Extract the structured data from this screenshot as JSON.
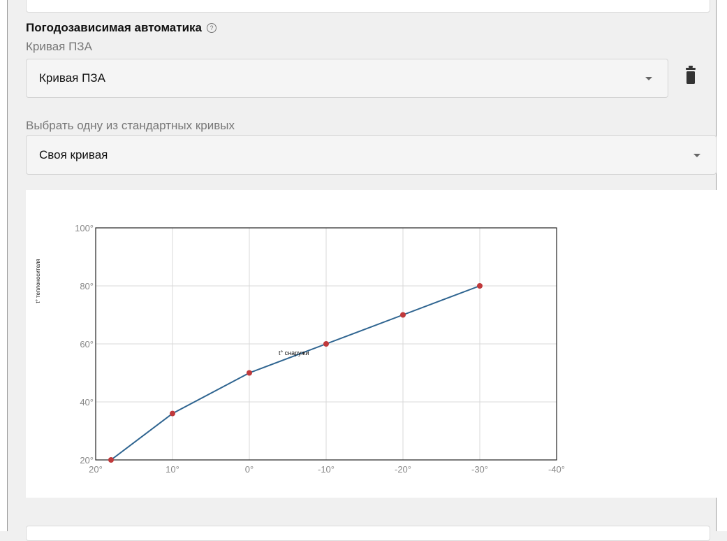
{
  "section": {
    "title": "Погодозависимая автоматика",
    "help_icon": "?"
  },
  "curve_field": {
    "label": "Кривая ПЗА",
    "value": "Кривая ПЗА"
  },
  "standard_field": {
    "label": "Выбрать одну из стандартных кривых",
    "value": "Своя кривая"
  },
  "chart_data": {
    "type": "line",
    "xlabel": "t° снаружи",
    "ylabel": "t° теплоносителя",
    "x_ticks": [
      "20°",
      "10°",
      "0°",
      "-10°",
      "-20°",
      "-30°",
      "-40°"
    ],
    "y_ticks": [
      "100°",
      "80°",
      "60°",
      "40°",
      "20°"
    ],
    "xlim": [
      20,
      -40
    ],
    "ylim": [
      20,
      100
    ],
    "grid": true,
    "line_color": "#2e6490",
    "point_color": "#c0393b",
    "series": [
      {
        "points": [
          {
            "x": 18,
            "y": 20
          },
          {
            "x": 10,
            "y": 36
          },
          {
            "x": 0,
            "y": 50
          },
          {
            "x": -10,
            "y": 60
          },
          {
            "x": -20,
            "y": 70
          },
          {
            "x": -30,
            "y": 80
          }
        ]
      }
    ]
  }
}
